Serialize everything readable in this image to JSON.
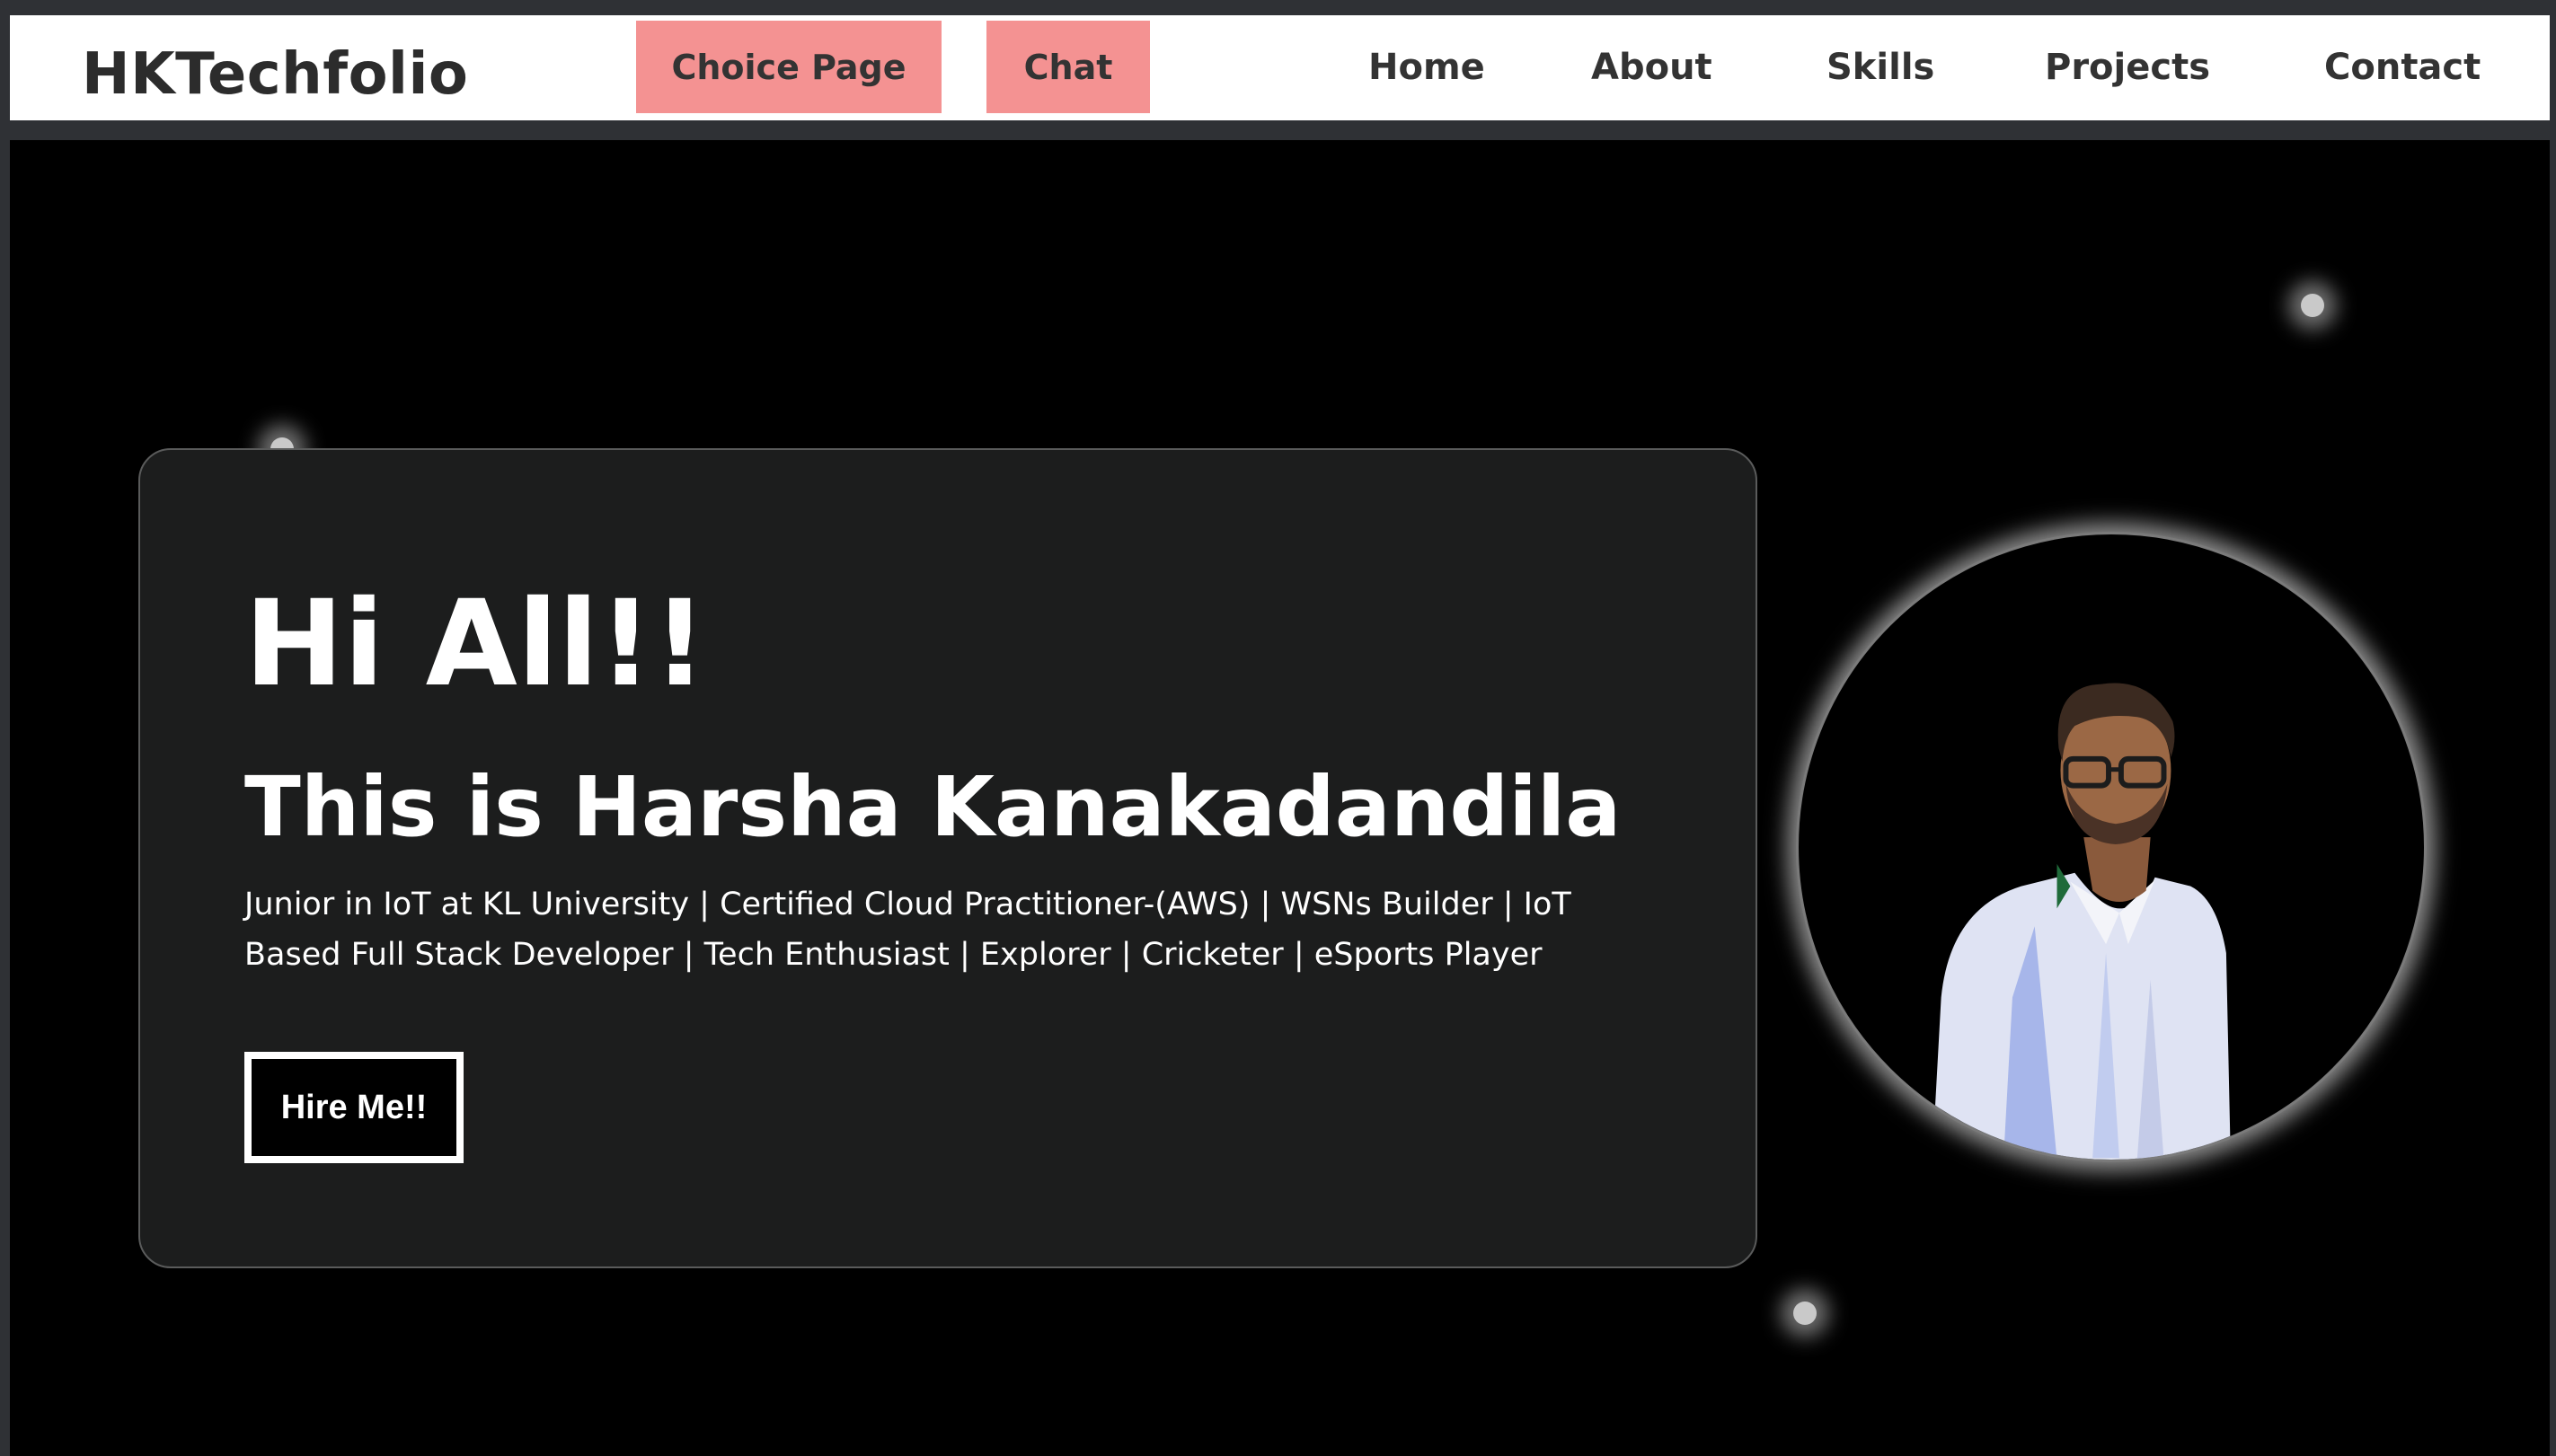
{
  "navbar": {
    "brand": "HKTechfolio",
    "pill_buttons": [
      "Choice Page",
      "Chat"
    ],
    "links": [
      "Home",
      "About",
      "Skills",
      "Projects",
      "Contact"
    ]
  },
  "hero": {
    "greeting": "Hi All!!",
    "name_line": "This is Harsha Kanakadandila",
    "tagline": "Junior in IoT at KL University | Certified Cloud Practitioner-(AWS) | WSNs Builder | IoT Based Full Stack Developer | Tech Enthusiast | Explorer | Cricketer | eSports Player",
    "hire_button": "Hire Me!!",
    "profile_image": "profile-photo"
  },
  "colors": {
    "pill_bg": "#f49292",
    "hero_bg": "#000000",
    "card_bg": "#1c1d1d",
    "page_frame": "#2f3135"
  }
}
